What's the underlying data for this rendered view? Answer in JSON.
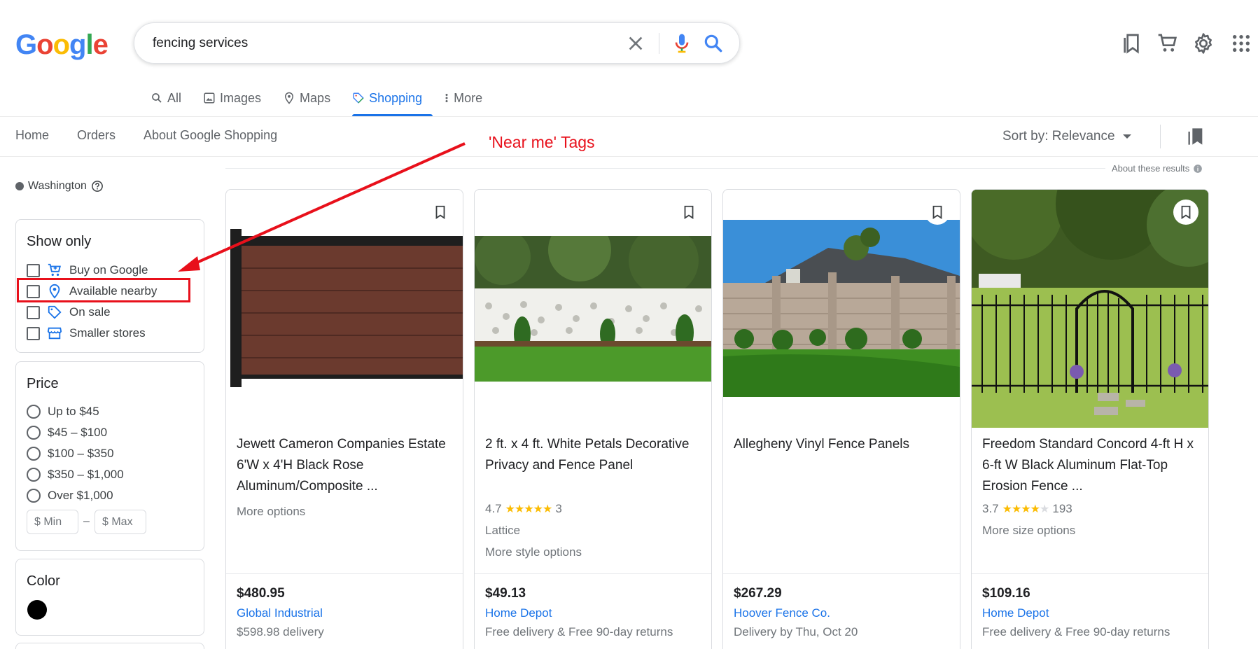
{
  "logo": {
    "letters": [
      "G",
      "o",
      "o",
      "g",
      "l",
      "e"
    ],
    "colors": [
      "#4285f4",
      "#ea4335",
      "#fbbc05",
      "#4285f4",
      "#34a853",
      "#ea4335"
    ]
  },
  "search": {
    "query": "fencing services"
  },
  "header_icons": [
    "bookmarks-icon",
    "cart-icon",
    "settings-icon",
    "apps-icon"
  ],
  "tabs": [
    {
      "label": "All",
      "icon": "search-icon"
    },
    {
      "label": "Images",
      "icon": "image-icon"
    },
    {
      "label": "Maps",
      "icon": "map-pin-icon"
    },
    {
      "label": "Shopping",
      "icon": "tag-icon",
      "active": true
    },
    {
      "label": "More",
      "icon": "more-vert-icon"
    }
  ],
  "shop_nav": {
    "home": "Home",
    "orders": "Orders",
    "about": "About Google Shopping"
  },
  "sort": {
    "label": "Sort by: Relevance"
  },
  "about_results": "About these results",
  "annotation": {
    "text": "'Near me' Tags",
    "color": "#e8101b"
  },
  "location": "Washington",
  "show_only": {
    "title": "Show only",
    "items": [
      "Buy on Google",
      "Available nearby",
      "On sale",
      "Smaller stores"
    ]
  },
  "price_filter": {
    "title": "Price",
    "options": [
      "Up to $45",
      "$45 – $100",
      "$100 – $350",
      "$350 – $1,000",
      "Over $1,000"
    ],
    "min_placeholder": "$ Min",
    "max_placeholder": "$ Max",
    "dash": "–"
  },
  "color_filter": {
    "title": "Color",
    "swatch": "#000000"
  },
  "products": [
    {
      "title": "Jewett Cameron Companies Estate 6'W x 4'H Black Rose Aluminum/Composite ...",
      "meta1": "More options",
      "price": "$480.95",
      "store": "Global Industrial",
      "delivery": "$598.98 delivery"
    },
    {
      "title": "2 ft. x 4 ft. White Petals Decorative Privacy and Fence Panel",
      "rating": "4.7",
      "reviews": "3",
      "stars": 4.7,
      "meta1": "Lattice",
      "meta2": "More style options",
      "price": "$49.13",
      "store": "Home Depot",
      "delivery": "Free delivery & Free 90-day returns"
    },
    {
      "title": "Allegheny Vinyl Fence Panels",
      "price": "$267.29",
      "store": "Hoover Fence Co.",
      "delivery": "Delivery by Thu, Oct 20"
    },
    {
      "title": "Freedom Standard Concord 4-ft H x 6-ft W Black Aluminum Flat-Top Erosion Fence ...",
      "rating": "3.7",
      "reviews": "193",
      "stars": 3.7,
      "meta1": "More size options",
      "price": "$109.16",
      "store": "Home Depot",
      "delivery": "Free delivery & Free 90-day returns"
    }
  ]
}
